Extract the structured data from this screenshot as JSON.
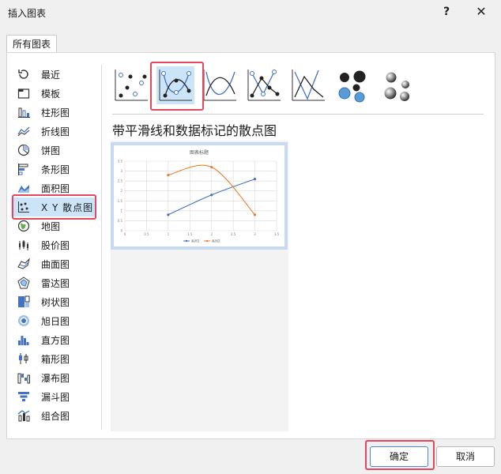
{
  "window": {
    "title": "插入图表",
    "help_label": "?",
    "close_label": "✕"
  },
  "tabs": [
    {
      "label": "所有图表"
    }
  ],
  "sidebar": {
    "items": [
      {
        "label": "最近",
        "icon": "recent-icon"
      },
      {
        "label": "模板",
        "icon": "template-icon"
      },
      {
        "label": "柱形图",
        "icon": "column-chart-icon"
      },
      {
        "label": "折线图",
        "icon": "line-chart-icon"
      },
      {
        "label": "饼图",
        "icon": "pie-chart-icon"
      },
      {
        "label": "条形图",
        "icon": "bar-chart-icon"
      },
      {
        "label": "面积图",
        "icon": "area-chart-icon"
      },
      {
        "label": "X Y 散点图",
        "icon": "scatter-chart-icon",
        "selected": true
      },
      {
        "label": "地图",
        "icon": "map-chart-icon"
      },
      {
        "label": "股价图",
        "icon": "stock-chart-icon"
      },
      {
        "label": "曲面图",
        "icon": "surface-chart-icon"
      },
      {
        "label": "雷达图",
        "icon": "radar-chart-icon"
      },
      {
        "label": "树状图",
        "icon": "treemap-chart-icon"
      },
      {
        "label": "旭日图",
        "icon": "sunburst-chart-icon"
      },
      {
        "label": "直方图",
        "icon": "histogram-chart-icon"
      },
      {
        "label": "箱形图",
        "icon": "box-whisker-chart-icon"
      },
      {
        "label": "瀑布图",
        "icon": "waterfall-chart-icon"
      },
      {
        "label": "漏斗图",
        "icon": "funnel-chart-icon"
      },
      {
        "label": "组合图",
        "icon": "combo-chart-icon"
      }
    ]
  },
  "subtypes": [
    {
      "icon": "scatter-markers-only-icon"
    },
    {
      "icon": "scatter-smooth-lines-markers-icon",
      "selected": true
    },
    {
      "icon": "scatter-smooth-lines-icon"
    },
    {
      "icon": "scatter-straight-lines-markers-icon"
    },
    {
      "icon": "scatter-straight-lines-icon"
    },
    {
      "icon": "bubble-chart-icon"
    },
    {
      "icon": "bubble-3d-chart-icon"
    }
  ],
  "selected_chart_name": "带平滑线和数据标记的散点图",
  "preview": {
    "chart_data": {
      "type": "scatter",
      "title": "图表标题",
      "x_ticks": [
        "0",
        "0.5",
        "1",
        "1.5",
        "2",
        "2.5",
        "3",
        "3.5"
      ],
      "y_ticks": [
        "0",
        "0.5",
        "1",
        "1.5",
        "2",
        "2.5",
        "3",
        "3.5"
      ],
      "xlim": [
        0,
        3.5
      ],
      "ylim": [
        0,
        3.5
      ],
      "smooth": true,
      "grid": true,
      "legend_position": "bottom",
      "series": [
        {
          "name": "系列1",
          "color": "#4472c4",
          "points": [
            [
              1,
              0.8
            ],
            [
              2,
              1.8
            ],
            [
              3,
              2.6
            ]
          ]
        },
        {
          "name": "系列2",
          "color": "#ed7d31",
          "points": [
            [
              1,
              2.8
            ],
            [
              2,
              3.2
            ],
            [
              3,
              0.8
            ]
          ]
        }
      ]
    }
  },
  "buttons": {
    "ok": "确定",
    "cancel": "取消"
  },
  "colors": {
    "selection": "#cce4f7",
    "highlight": "#e0485f",
    "accent_blue": "#2e75b6"
  }
}
